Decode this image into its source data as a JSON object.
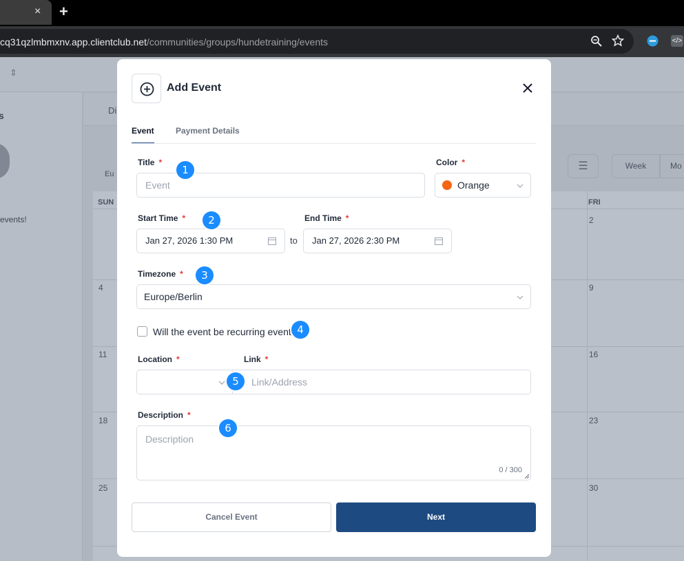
{
  "browser": {
    "tab_close": "×",
    "new_tab": "+",
    "url_host": "cq31qzlmbmxnv.app.clientclub.net",
    "url_path": "/communities/groups/hundetraining/events"
  },
  "background_page": {
    "sidebar_heading": "s",
    "no_events_text": "events!",
    "toolbar_label": "Di",
    "toolbar_sub": "Eu",
    "view_week": "Week",
    "view_month": "Mo",
    "day_headers": [
      "SUN",
      "FRI"
    ],
    "dates_left": [
      "4",
      "11",
      "18",
      "25"
    ],
    "dates_right": [
      "2",
      "9",
      "16",
      "23",
      "30"
    ]
  },
  "modal": {
    "title": "Add Event",
    "tabs": {
      "event": "Event",
      "payment": "Payment Details"
    },
    "fields": {
      "title_label": "Title",
      "title_placeholder": "Event",
      "color_label": "Color",
      "color_value": "Orange",
      "start_label": "Start Time",
      "start_value": "Jan 27, 2026 1:30 PM",
      "to_text": "to",
      "end_label": "End Time",
      "end_value": "Jan 27, 2026 2:30 PM",
      "timezone_label": "Timezone",
      "timezone_value": "Europe/Berlin",
      "recurring_label": "Will the event be recurring event?",
      "location_label": "Location",
      "link_label": "Link",
      "link_placeholder": "Link/Address",
      "description_label": "Description",
      "description_placeholder": "Description",
      "description_count": "0 / 300",
      "required_mark": "*"
    },
    "buttons": {
      "cancel": "Cancel Event",
      "next": "Next"
    }
  },
  "markers": [
    "1",
    "2",
    "3",
    "4",
    "5",
    "6"
  ],
  "colors": {
    "primary": "#1e4a82",
    "marker": "#1a8cff",
    "orange_swatch": "#f56512",
    "required": "#e53935"
  }
}
